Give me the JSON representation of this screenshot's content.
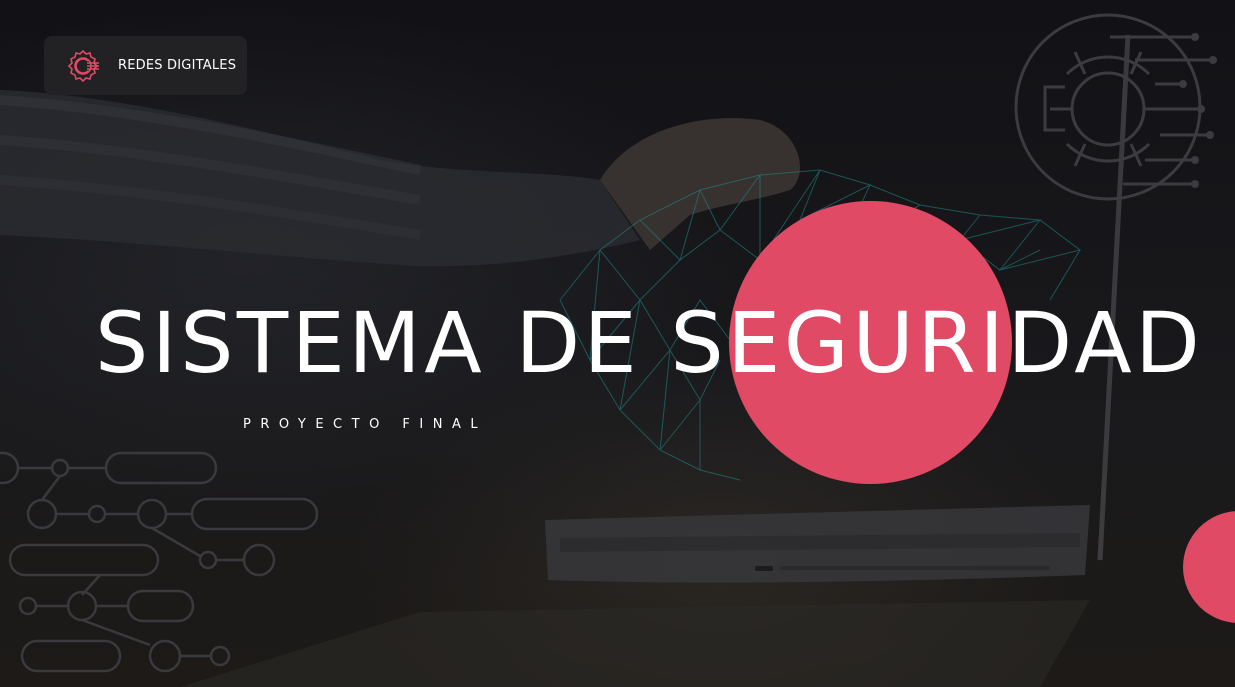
{
  "brand": {
    "name": "REDES DIGITALES",
    "logo_icon": "gear-chip-icon",
    "logo_color": "#e04a64"
  },
  "title": "SISTEMA DE SEGURIDAD",
  "subtitle": "PROYECTO FINAL",
  "decorations": {
    "accent_color": "#e04a64",
    "background_icon": "gear-circuit-icon",
    "circuit_pattern": "circuit-lines",
    "background_photo": "handshake with digital wireframe hand over laptop"
  }
}
